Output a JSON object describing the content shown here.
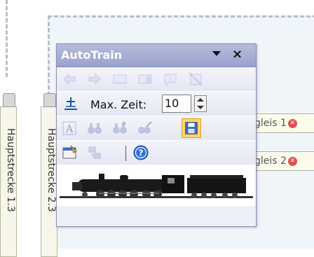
{
  "panel": {
    "title": "AutoTrain",
    "time_label": "Max. Zeit:",
    "time_value": "10"
  },
  "tracks": {
    "left_label": "Hauptstrecke 1.3",
    "right_label": "Hauptstrecke 2.3",
    "gleis_1": "gleis 1",
    "gleis_2": "gleis 2"
  },
  "colors": {
    "title_bar": "#9aa2cc",
    "panel_bg": "#eef0f8",
    "selected": "#ffd56a",
    "error_badge": "#e05050"
  },
  "icons": [
    "arrow-left-icon",
    "arrow-right-icon",
    "block-icon",
    "block-half-icon",
    "signal-icon",
    "erase-icon",
    "add-track-icon",
    "font-icon",
    "binoculars-icon",
    "binoculars-plus-icon",
    "binoculars-edit-icon",
    "save-icon",
    "properties-icon",
    "network-icon",
    "help-icon",
    "locomotive-image"
  ]
}
